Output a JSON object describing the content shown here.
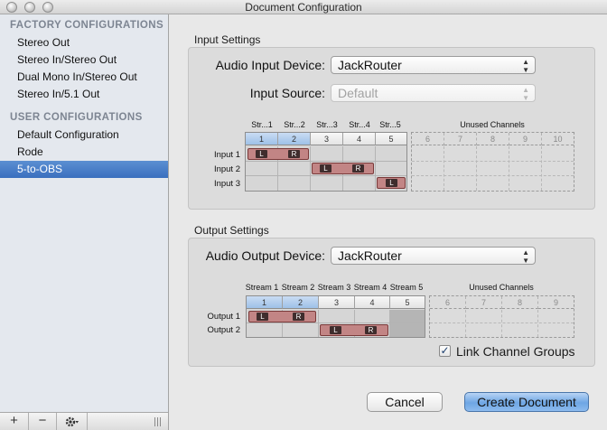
{
  "window": {
    "title": "Document Configuration"
  },
  "sidebar": {
    "factory_header": "FACTORY CONFIGURATIONS",
    "factory_items": [
      "Stereo Out",
      "Stereo In/Stereo Out",
      "Dual Mono In/Stereo Out",
      "Stereo In/5.1 Out"
    ],
    "user_header": "USER CONFIGURATIONS",
    "user_items": [
      "Default Configuration",
      "Rode",
      "5-to-OBS"
    ],
    "selected": "5-to-OBS",
    "add_label": "+",
    "remove_label": "−",
    "gear_icon": "gear-icon"
  },
  "input": {
    "group_label": "Input Settings",
    "device_label": "Audio Input Device:",
    "device_value": "JackRouter",
    "source_label": "Input Source:",
    "source_value": "Default",
    "stream_headers": [
      "Str...1",
      "Str...2",
      "Str...3",
      "Str...4",
      "Str...5"
    ],
    "unused_title": "Unused Channels",
    "channel_numbers": [
      "1",
      "2",
      "3",
      "4",
      "5"
    ],
    "unused_numbers": [
      "6",
      "7",
      "8",
      "9",
      "10"
    ],
    "rows": [
      "Input 1",
      "Input 2",
      "Input 3"
    ],
    "lr": {
      "l": "L",
      "r": "R"
    }
  },
  "output": {
    "group_label": "Output Settings",
    "device_label": "Audio Output Device:",
    "device_value": "JackRouter",
    "stream_headers": [
      "Stream 1",
      "Stream 2",
      "Stream 3",
      "Stream 4",
      "Stream 5"
    ],
    "unused_title": "Unused Channels",
    "channel_numbers": [
      "1",
      "2",
      "3",
      "4",
      "5"
    ],
    "unused_numbers": [
      "6",
      "7",
      "8",
      "9"
    ],
    "rows": [
      "Output 1",
      "Output 2"
    ],
    "link_label": "Link Channel Groups",
    "link_checked": true,
    "check_mark": "✓"
  },
  "buttons": {
    "cancel": "Cancel",
    "create": "Create Document"
  },
  "colors": {
    "selection": "#3a6fbe",
    "channel_bar": "#c28585",
    "default_button": "#6ea6e4"
  }
}
